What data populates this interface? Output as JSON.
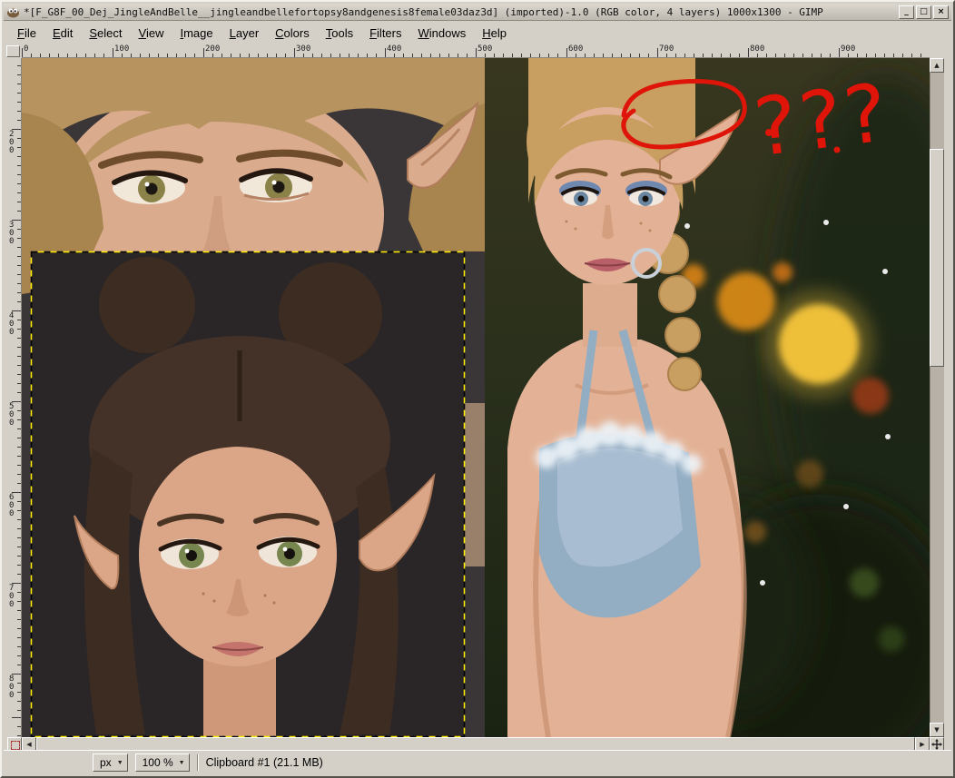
{
  "window": {
    "title": "*[F_G8F_00_Dej_JingleAndBelle__jingleandbellefortopsy8andgenesis8female03daz3d] (imported)-1.0 (RGB color, 4 layers) 1000x1300 - GIMP",
    "icons": {
      "minimize": "_",
      "maximize": "□",
      "close": "×"
    }
  },
  "menu_bar": {
    "items": [
      "File",
      "Edit",
      "Select",
      "View",
      "Image",
      "Layer",
      "Colors",
      "Tools",
      "Filters",
      "Windows",
      "Help"
    ]
  },
  "rulers": {
    "horizontal": [
      "0",
      "100",
      "200",
      "300",
      "400",
      "500",
      "600",
      "700",
      "800",
      "900"
    ],
    "vertical": [
      "200",
      "300",
      "400",
      "500",
      "600",
      "700",
      "800"
    ]
  },
  "canvas": {
    "annotation": {
      "text": "???"
    }
  },
  "status_bar": {
    "unit": "px",
    "zoom": "100 %",
    "message": "Clipboard #1 (21.1 MB)"
  },
  "icons": {
    "chevron_down": "▼",
    "scroll_up": "▲",
    "scroll_down": "▼",
    "scroll_left": "◀",
    "scroll_right": "▶"
  },
  "colors": {
    "window_chrome": "#d4d0c8",
    "canvas_dark_bg": "#3a3637",
    "annotation_red": "#de1508",
    "layer_boundary_yellow": "#ffee00",
    "layer_boundary_black": "#000000"
  }
}
